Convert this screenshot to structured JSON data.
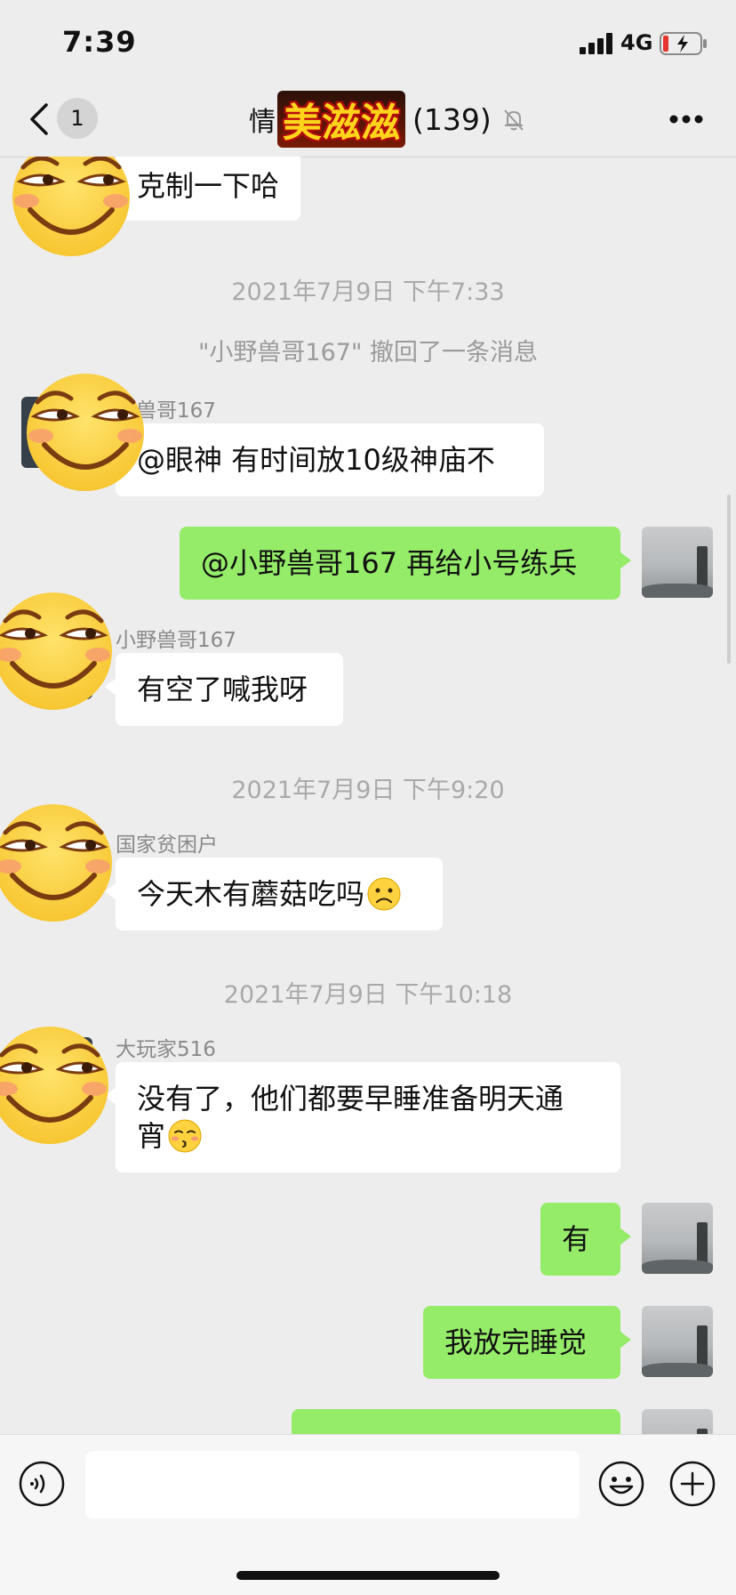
{
  "status_bar": {
    "time": "7:39",
    "network": "4G"
  },
  "nav": {
    "unread_count": "1",
    "title_prefix": "情",
    "title_logo": "美滋滋",
    "member_count": "(139)"
  },
  "messages": {
    "top_bubble": "克制一下哈",
    "ts1": "2021年7月9日 下午7:33",
    "recall_notice": "\"小野兽哥167\" 撤回了一条消息",
    "sender1": "野兽哥167",
    "msg1": "@眼神 有时间放10级神庙不",
    "out1": "@小野兽哥167 再给小号练兵",
    "sender2": "小野兽哥167",
    "msg2": "有空了喊我呀",
    "ts2": "2021年7月9日 下午9:20",
    "sender3": "国家贫困户",
    "msg3": "今天木有蘑菇吃吗",
    "ts3": "2021年7月9日 下午10:18",
    "sender4": "大玩家516",
    "msg4_line1": "没有了，他们都要早睡准备明天通",
    "msg4_line2": "宵",
    "out2": "有",
    "out3": "我放完睡觉"
  },
  "icons": {
    "sticker": "smirk-emoji-sticker",
    "inline_sad": "sad-face-emoji",
    "inline_kiss": "kissing-closed-eyes-emoji"
  },
  "colors": {
    "bubble_out": "#95ec69",
    "bubble_in": "#ffffff",
    "background": "#ededed"
  }
}
